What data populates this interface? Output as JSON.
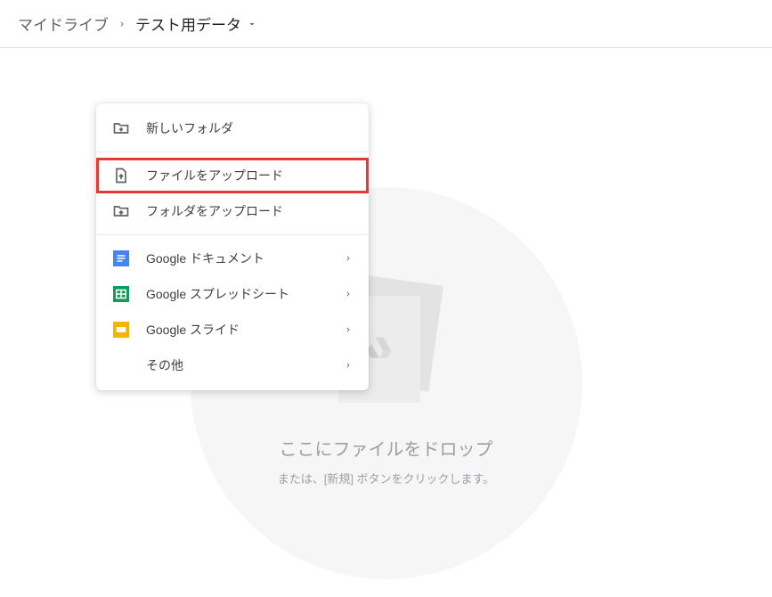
{
  "breadcrumb": {
    "root": "マイドライブ",
    "current": "テスト用データ"
  },
  "menu": {
    "new_folder": "新しいフォルダ",
    "file_upload": "ファイルをアップロード",
    "folder_upload": "フォルダをアップロード",
    "google_docs": "Google ドキュメント",
    "google_sheets": "Google スプレッドシート",
    "google_slides": "Google スライド",
    "more": "その他"
  },
  "drop": {
    "title": "ここにファイルをドロップ",
    "subtitle": "または、[新規] ボタンをクリックします。"
  },
  "colors": {
    "docs": "#4285f4",
    "sheets": "#0f9d58",
    "slides": "#f4b400",
    "highlight": "#e53935"
  }
}
